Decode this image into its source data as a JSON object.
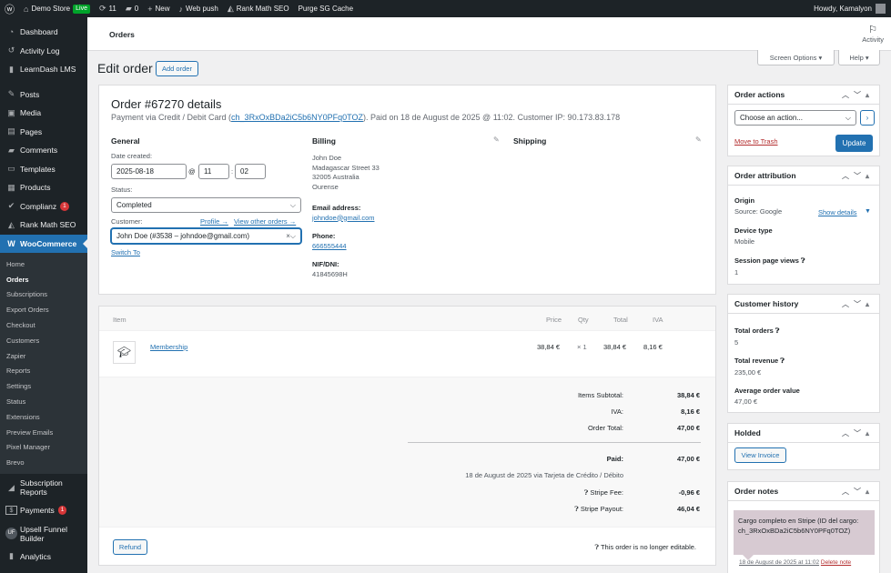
{
  "adminbar": {
    "wp": "ⓦ",
    "site": "Demo Store",
    "live": "Live",
    "updates": "11",
    "comments": "0",
    "new": "New",
    "webpush": "Web push",
    "rankmath": "Rank Math SEO",
    "purge": "Purge SG Cache",
    "howdy": "Howdy, Kamalyon"
  },
  "sidebar": {
    "items_top": [
      {
        "icon": "◔",
        "label": "Dashboard"
      },
      {
        "icon": "↺",
        "label": "Activity Log"
      },
      {
        "icon": "▮",
        "label": "LearnDash LMS"
      }
    ],
    "items_mid": [
      {
        "icon": "✎",
        "label": "Posts"
      },
      {
        "icon": "▣",
        "label": "Media"
      },
      {
        "icon": "▤",
        "label": "Pages"
      },
      {
        "icon": "▰",
        "label": "Comments"
      },
      {
        "icon": "▭",
        "label": "Templates"
      },
      {
        "icon": "▦",
        "label": "Products"
      },
      {
        "icon": "✔",
        "label": "Complianz",
        "badge": "1"
      },
      {
        "icon": "◭",
        "label": "Rank Math SEO"
      }
    ],
    "woocommerce": "WooCommerce",
    "woo_sub": [
      "Home",
      "Orders",
      "Subscriptions",
      "Export Orders",
      "Checkout",
      "Customers",
      "Zapier",
      "Reports",
      "Settings",
      "Status",
      "Extensions",
      "Preview Emails",
      "Pixel Manager",
      "Brevo"
    ],
    "items_bottom": [
      {
        "icon": "◢",
        "label": "Subscription Reports"
      },
      {
        "icon": "$",
        "label": "Payments",
        "badge": "1"
      },
      {
        "icon": "UF",
        "label": "Upsell Funnel Builder"
      },
      {
        "icon": "▮",
        "label": "Analytics"
      }
    ]
  },
  "header": {
    "crumb": "Orders",
    "activity": "Activity",
    "screen_options": "Screen Options ▾",
    "help": "Help ▾",
    "title": "Edit order",
    "add_order": "Add order"
  },
  "order": {
    "title": "Order #67270 details",
    "sub_prefix": "Payment via Credit / Debit Card (",
    "charge": "ch_3RxOxBDa2iC5b6NY0PFq0TOZ",
    "sub_suffix": "). Paid on 18 de August de 2025 @ 11:02. Customer IP: 90.173.83.178",
    "general": "General",
    "date_label": "Date created:",
    "date": "2025-08-18",
    "at": "@",
    "hour": "11",
    "minute": "02",
    "status_label": "Status:",
    "status": "Completed",
    "customer_label": "Customer:",
    "profile": "Profile →",
    "view_other": "View other orders →",
    "customer": "John Doe (#3538 – johndoe@gmail.com)",
    "switch_to": "Switch To",
    "billing": "Billing",
    "bill_name": "John Doe",
    "bill_street": "Madagascar Street 33",
    "bill_city": "32005 Australia",
    "bill_region": "Ourense",
    "email_label": "Email address:",
    "email": "johndoe@gmail.com",
    "phone_label": "Phone:",
    "phone": "666555444",
    "nif_label": "NIF/DNI:",
    "nif": "41845698H",
    "shipping": "Shipping"
  },
  "items": {
    "headers": {
      "item": "Item",
      "price": "Price",
      "qty": "Qty",
      "total": "Total",
      "iva": "IVA"
    },
    "row": {
      "name": "Membership",
      "price": "38,84 €",
      "qty": "× 1",
      "total": "38,84 €",
      "iva": "8,16 €"
    },
    "totals": [
      {
        "label": "Items Subtotal:",
        "value": "38,84 €"
      },
      {
        "label": "IVA:",
        "value": "8,16 €"
      },
      {
        "label": "Order Total:",
        "value": "47,00 €"
      }
    ],
    "paid_label": "Paid:",
    "paid_value": "47,00 €",
    "paid_note": "18 de August de 2025 via Tarjeta de Crédito / Débito",
    "fee_label": "Stripe Fee:",
    "fee_value": "-0,96 €",
    "payout_label": "Stripe Payout:",
    "payout_value": "46,04 €",
    "refund": "Refund",
    "not_editable": "This order is no longer editable."
  },
  "actions": {
    "title": "Order actions",
    "select": "Choose an action...",
    "trash": "Move to Trash",
    "update": "Update"
  },
  "attribution": {
    "title": "Order attribution",
    "origin_label": "Origin",
    "origin": "Source: Google",
    "show_details": "Show details",
    "device_label": "Device type",
    "device": "Mobile",
    "views_label": "Session page views",
    "views": "1"
  },
  "history": {
    "title": "Customer history",
    "orders_label": "Total orders",
    "orders": "5",
    "revenue_label": "Total revenue",
    "revenue": "235,00 €",
    "avg_label": "Average order value",
    "avg": "47,00 €"
  },
  "holded": {
    "title": "Holded",
    "button": "View Invoice"
  },
  "notes": {
    "title": "Order notes",
    "note": "Cargo completo en Stripe (ID del cargo: ch_3RxOxBDa2iC5b6NY0PFq0TOZ)",
    "date": "18 de August de 2025 at 11:02",
    "delete": "Delete note"
  }
}
